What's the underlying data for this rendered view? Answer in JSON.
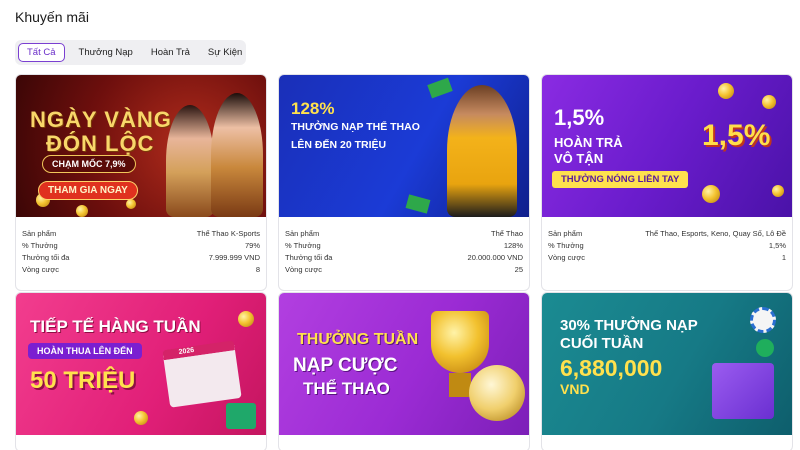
{
  "page": {
    "title": "Khuyến mãi"
  },
  "tabs": [
    {
      "label": "Tất Cả",
      "active": true
    },
    {
      "label": "Thưởng Nạp",
      "active": false
    },
    {
      "label": "Hoàn Trả",
      "active": false
    },
    {
      "label": "Sự Kiện",
      "active": false
    }
  ],
  "promos": [
    {
      "banner": {
        "line1": "NGÀY VÀNG",
        "line2": "ĐÓN LỘC",
        "line3": "CHẠM MỐC 7,9%",
        "cta": "THAM GIA NGAY"
      },
      "labels": {
        "product": "Sản phẩm",
        "bonus": "% Thưởng",
        "max": "Thưởng tối đa",
        "rounds": "Vòng cược"
      },
      "values": {
        "product": "Thể Thao K-Sports",
        "bonus": "79%",
        "max": "7.999.999 VND",
        "rounds": "8"
      }
    },
    {
      "banner": {
        "line1": "128%",
        "line2": "THƯỞNG NẠP THỂ THAO",
        "line3": "LÊN ĐẾN 20 TRIỆU"
      },
      "labels": {
        "product": "Sản phẩm",
        "bonus": "% Thưởng",
        "max": "Thưởng tối đa",
        "rounds": "Vòng cược"
      },
      "values": {
        "product": "Thể Thao",
        "bonus": "128%",
        "max": "20.000.000 VND",
        "rounds": "25"
      }
    },
    {
      "banner": {
        "line1": "1,5%",
        "line2": "HOÀN TRẢ",
        "line3": "VÔ TẬN",
        "line4": "THƯỞNG NÓNG LIỀN TAY",
        "badge": "1,5%"
      },
      "labels": {
        "product": "Sản phẩm",
        "bonus": "% Thưởng",
        "rounds": "Vòng cược"
      },
      "values": {
        "product": "Thể Thao, Esports, Keno, Quay Số, Lô Đề",
        "bonus": "1,5%",
        "rounds": "1"
      }
    },
    {
      "banner": {
        "line1": "TIẾP TẾ HÀNG TUẦN",
        "line2": "HOÀN THUA LÊN ĐẾN",
        "line3": "50 TRIỆU",
        "calendar": "2026"
      }
    },
    {
      "banner": {
        "line1": "THƯỞNG TUẦN",
        "line2": "NẠP CƯỢC",
        "line3": "THỂ THAO"
      }
    },
    {
      "banner": {
        "line1": "30% THƯỞNG NẠP",
        "line2": "CUỐI TUẦN",
        "line3": "6,880,000",
        "line4": "VND"
      }
    }
  ],
  "colors": {
    "accent": "#6b2fc9",
    "tab_bg": "#efeff2",
    "card_border": "#e3e3e8"
  }
}
